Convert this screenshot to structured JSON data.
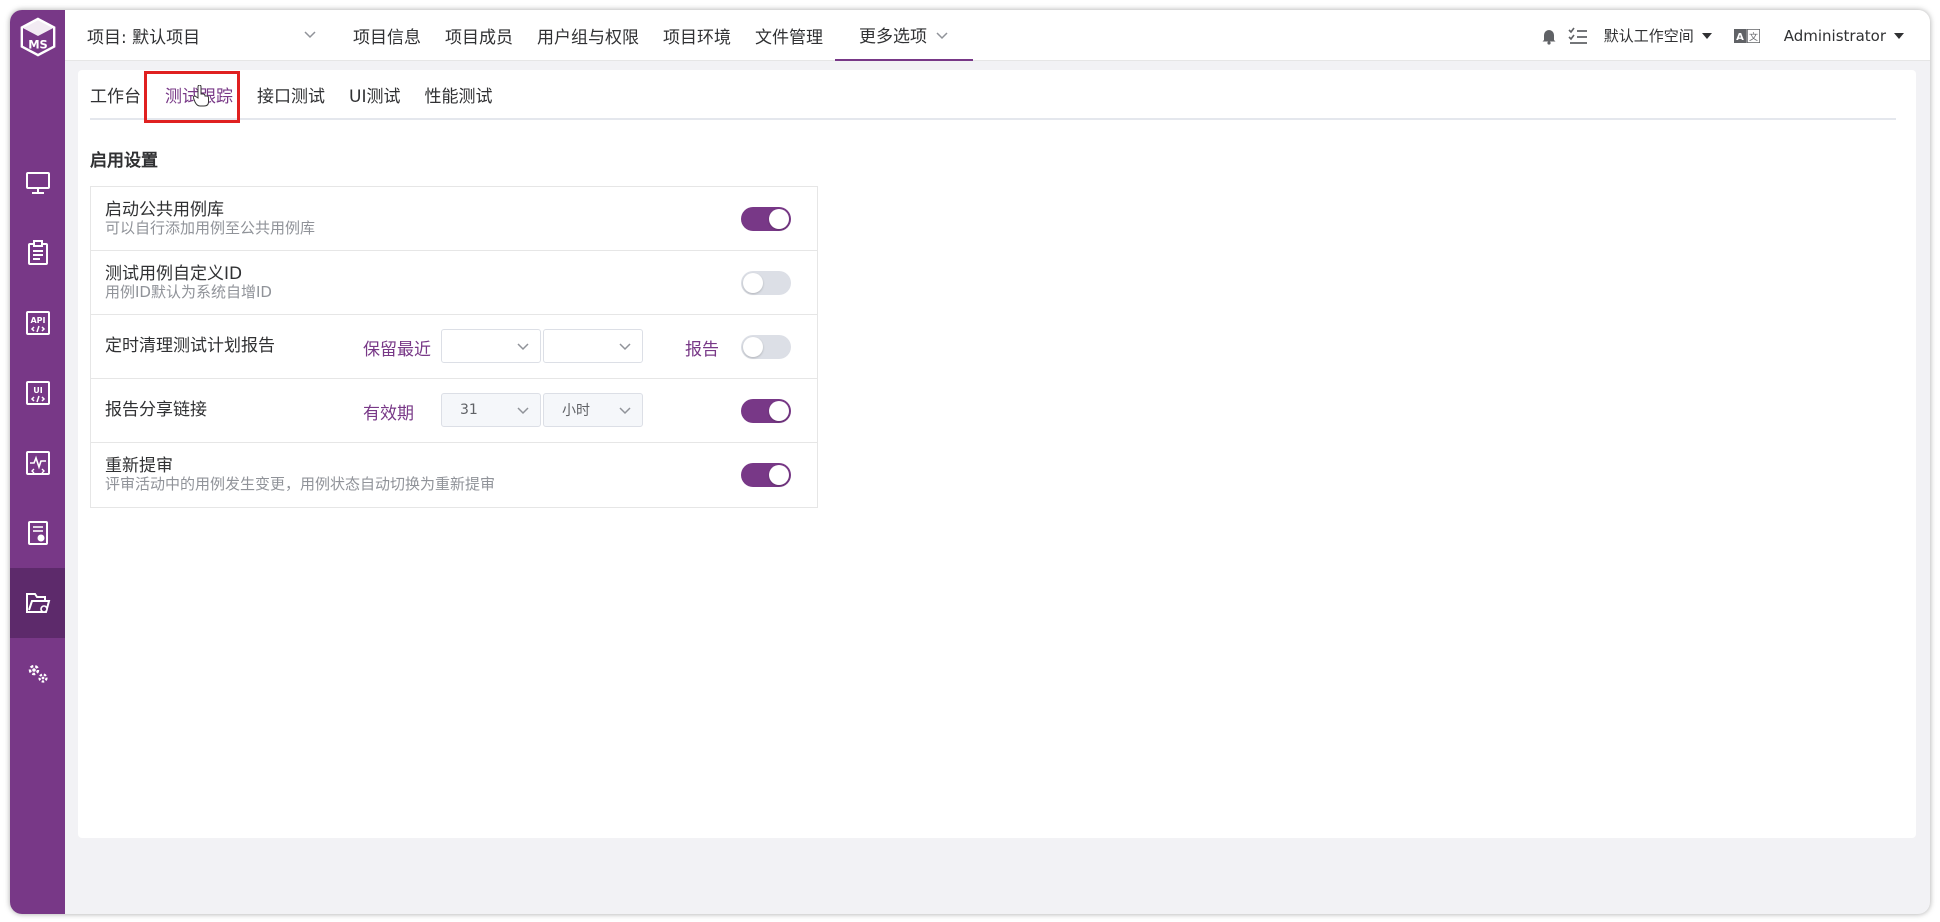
{
  "colors": {
    "brand": "#783887",
    "sidebar_active": "#5d2a6b",
    "highlight": "#e02020"
  },
  "logo": {
    "text": "MS"
  },
  "sidebar": {
    "items": [
      {
        "icon": "monitor-icon"
      },
      {
        "icon": "clipboard-icon"
      },
      {
        "icon": "api-icon",
        "text": "API"
      },
      {
        "icon": "ui-icon",
        "text": "UI"
      },
      {
        "icon": "performance-icon"
      },
      {
        "icon": "report-icon"
      },
      {
        "icon": "project-settings-icon",
        "active": true
      },
      {
        "icon": "system-settings-icon"
      }
    ]
  },
  "header": {
    "project_label": "项目: 默认项目",
    "menu": [
      "项目信息",
      "项目成员",
      "用户组与权限",
      "项目环境",
      "文件管理"
    ],
    "more": "更多选项",
    "workspace": "默认工作空间",
    "user": "Administrator"
  },
  "tabs": [
    "工作台",
    "测试跟踪",
    "接口测试",
    "UI测试",
    "性能测试"
  ],
  "active_tab": "测试跟踪",
  "section_title": "启用设置",
  "settings": {
    "public_case": {
      "title": "启动公共用例库",
      "desc": "可以自行添加用例至公共用例库",
      "enabled": true
    },
    "custom_id": {
      "title": "测试用例自定义ID",
      "desc": "用例ID默认为系统自增ID",
      "enabled": false
    },
    "clean_report": {
      "title": "定时清理测试计划报告",
      "keep_label": "保留最近",
      "select1": "",
      "select2": "",
      "suffix": "报告",
      "enabled": false
    },
    "share_link": {
      "title": "报告分享链接",
      "valid_label": "有效期",
      "value": "31",
      "unit": "小时",
      "enabled": true
    },
    "re_review": {
      "title": "重新提审",
      "desc": "评审活动中的用例发生变更，用例状态自动切换为重新提审",
      "enabled": true
    }
  }
}
